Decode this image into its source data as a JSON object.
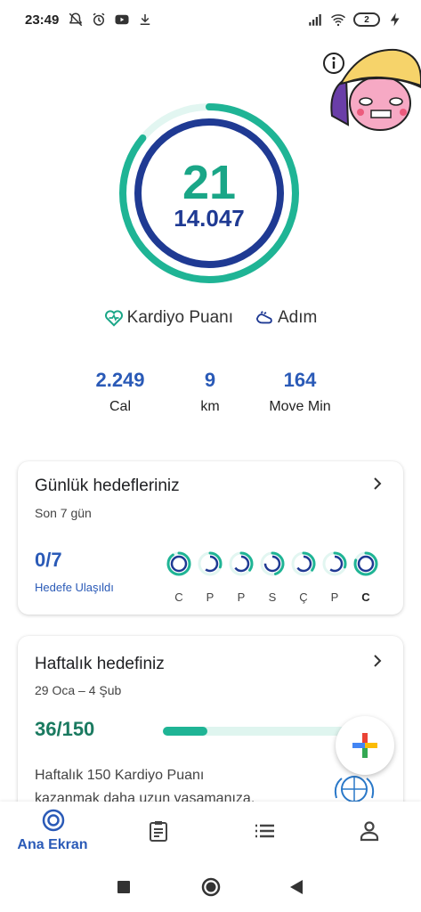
{
  "status_bar": {
    "time": "23:49",
    "battery": "2"
  },
  "ring": {
    "heart_points": "21",
    "steps": "14.047",
    "heart_points_progress": 0.86,
    "steps_progress": 1.0,
    "colors": {
      "heart": "#1fb495",
      "steps": "#1f3a93",
      "track": "#e2f6f1"
    }
  },
  "legend": {
    "heart": "Kardiyo Puanı",
    "steps": "Adım"
  },
  "stats": [
    {
      "value": "2.249",
      "label": "Cal"
    },
    {
      "value": "9",
      "label": "km"
    },
    {
      "value": "164",
      "label": "Move Min"
    }
  ],
  "daily_goals": {
    "title": "Günlük hedefleriniz",
    "subtitle": "Son 7 gün",
    "value": "0/7",
    "value_label": "Hedefe Ulaşıldı",
    "days": [
      {
        "label": "C",
        "progress": 0.9
      },
      {
        "label": "P",
        "progress": 0.3
      },
      {
        "label": "P",
        "progress": 0.35
      },
      {
        "label": "S",
        "progress": 0.45
      },
      {
        "label": "Ç",
        "progress": 0.35
      },
      {
        "label": "P",
        "progress": 0.3
      },
      {
        "label": "C",
        "progress": 0.8,
        "today": true
      }
    ]
  },
  "weekly_goal": {
    "title": "Haftalık hedefiniz",
    "date_range": "29 Oca – 4 Şub",
    "value": "36/150",
    "progress": 0.24,
    "desc_line1": "Haftalık 150 Kardiyo Puanı",
    "desc_line2": "kazanmak daha uzun yaşamanıza,"
  },
  "bottom_nav": {
    "home": "Ana Ekran"
  }
}
